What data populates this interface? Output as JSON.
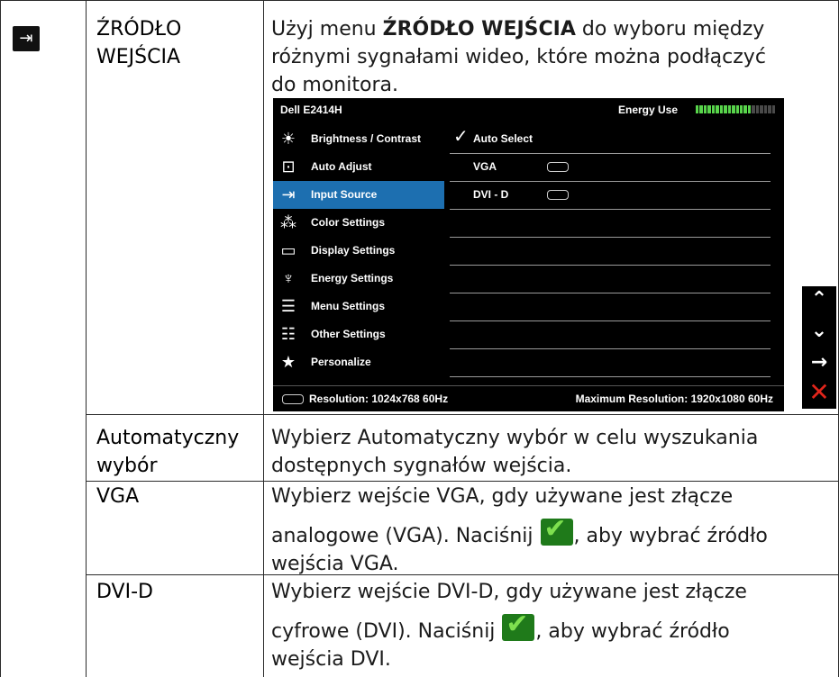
{
  "rows": {
    "input_source": {
      "label_line1": "ŹRÓDŁO",
      "label_line2": "WEJŚCIA",
      "desc_prefix": "Użyj menu ",
      "desc_bold": "ŹRÓDŁO WEJŚCIA",
      "desc_suffix": " do wyboru między",
      "desc_line2": "różnymi sygnałami wideo, które można podłączyć",
      "desc_line3": "do monitora."
    },
    "auto_select": {
      "label_line1": "Automatyczny",
      "label_line2": "wybór",
      "desc_line1": "Wybierz Automatyczny wybór w celu wyszukania",
      "desc_line2": "dostępnych sygnałów wejścia."
    },
    "vga": {
      "label": "VGA",
      "desc_line1": "Wybierz wejście VGA, gdy używane jest złącze",
      "desc_line2_a": "analogowe (VGA). Naciśnij ",
      "desc_line2_b": ", aby wybrać źródło",
      "desc_line3": "wejścia VGA."
    },
    "dvi": {
      "label": "DVI-D",
      "desc_line1": "Wybierz wejście DVI-D, gdy używane jest złącze",
      "desc_line2_a": "cyfrowe (DVI). Naciśnij ",
      "desc_line2_b": ", aby wybrać źródło",
      "desc_line3": "wejścia DVI."
    }
  },
  "osd": {
    "title": "Dell E2414H",
    "energy_label": "Energy Use",
    "energy_level_fraction": 0.7,
    "menu": [
      {
        "label": "Brightness / Contrast",
        "icon": "brightness-icon"
      },
      {
        "label": "Auto Adjust",
        "icon": "auto-adjust-icon"
      },
      {
        "label": "Input Source",
        "icon": "input-source-icon",
        "active": true
      },
      {
        "label": "Color Settings",
        "icon": "color-settings-icon"
      },
      {
        "label": "Display Settings",
        "icon": "display-settings-icon"
      },
      {
        "label": "Energy Settings",
        "icon": "energy-settings-icon"
      },
      {
        "label": "Menu Settings",
        "icon": "menu-settings-icon"
      },
      {
        "label": "Other Settings",
        "icon": "other-settings-icon"
      },
      {
        "label": "Personalize",
        "icon": "star-icon"
      }
    ],
    "submenu": [
      {
        "label": "Auto Select",
        "checked": true
      },
      {
        "label": "VGA",
        "connector": "vga-connector-icon"
      },
      {
        "label": "DVI - D",
        "connector": "dvi-connector-icon"
      }
    ],
    "footer": {
      "resolution": "Resolution:  1024x768 60Hz",
      "max_resolution": "Maximum Resolution: 1920x1080 60Hz"
    }
  },
  "side_buttons": [
    "up-arrow-icon",
    "down-arrow-icon",
    "right-arrow-icon",
    "close-icon"
  ]
}
